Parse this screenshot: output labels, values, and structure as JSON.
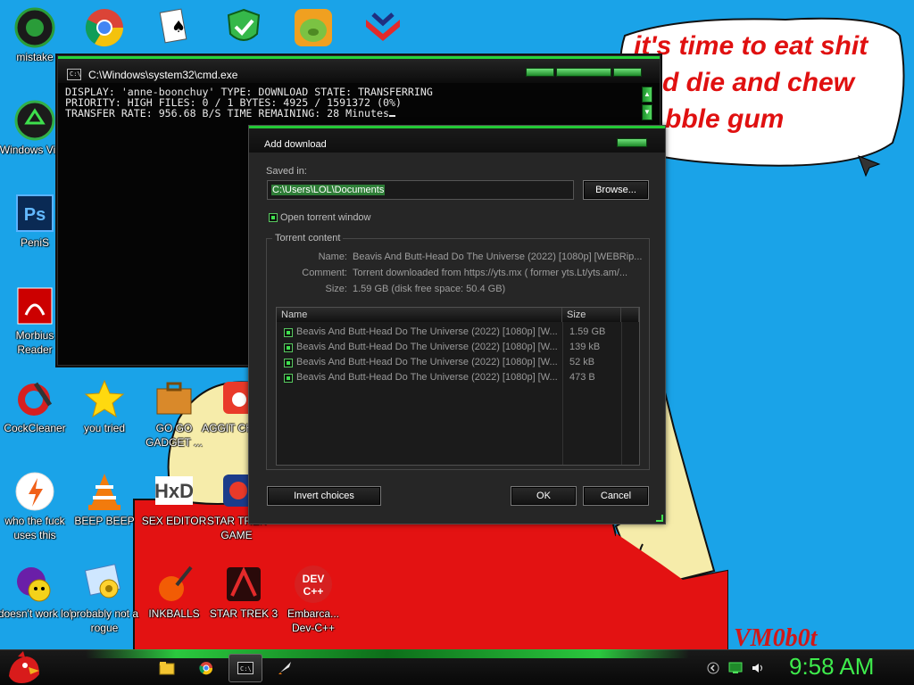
{
  "wallpaper": {
    "bubble_lines": [
      "it's time to eat shit",
      "d die and chew",
      "bble gum"
    ],
    "signature": "VM0b0t"
  },
  "desktop_icons": [
    {
      "label": "mistake",
      "icon": "xbox-app-icon"
    },
    {
      "label": "Windows Vista",
      "icon": "recycle-bin-icon"
    },
    {
      "label": "PeniS",
      "icon": "photoshop-icon"
    },
    {
      "label": "Morbius Reader",
      "icon": "pdf-reader-icon"
    },
    {
      "label": "CockCleaner",
      "icon": "ccleaner-icon"
    },
    {
      "label": "who the fuck uses this",
      "icon": "avast-icon"
    },
    {
      "label": "doesn't work lol",
      "icon": "yahoo-messenger-icon"
    },
    {
      "label": "",
      "icon": "chrome-icon"
    },
    {
      "label": "you tried",
      "icon": "star-icon"
    },
    {
      "label": "BEEP BEEP",
      "icon": "vlc-icon"
    },
    {
      "label": "probably not a rogue",
      "icon": "control-panel-icon"
    },
    {
      "label": "",
      "icon": "solitaire-icon"
    },
    {
      "label": "GO GO GADGET ...",
      "icon": "briefcase-icon"
    },
    {
      "label": "SEX EDITOR",
      "icon": "hxd-icon"
    },
    {
      "label": "INKBALLS",
      "icon": "inkball-icon"
    },
    {
      "label": "",
      "icon": "security-shield-icon"
    },
    {
      "label": "AGGIT CHICK",
      "icon": "angry-birds-icon"
    },
    {
      "label": "STAR TREK GAME",
      "icon": "star-wars-game-icon"
    },
    {
      "label": "STAR TREK 3",
      "icon": "star-wars-3-icon"
    },
    {
      "label": "",
      "icon": "bad-piggies-icon"
    },
    {
      "label": "",
      "icon": "winamp-icon"
    },
    {
      "label": "Embarca... Dev-C++",
      "icon": "dev-cpp-icon"
    }
  ],
  "cmd": {
    "title": "C:\\Windows\\system32\\cmd.exe",
    "app_icon_text": "C:\\",
    "lines": [
      "DISPLAY: 'anne-boonchuy' TYPE: DOWNLOAD STATE: TRANSFERRING",
      "PRIORITY: HIGH FILES: 0 / 1 BYTES: 4925 / 1591372 (0%)",
      "TRANSFER RATE: 956.68 B/S TIME REMAINING: 28 Minutes"
    ],
    "scroll_up": "▲",
    "scroll_down": "▼"
  },
  "dialog": {
    "title": "Add download",
    "saved_in_label": "Saved in:",
    "saved_in_value": "C:\\Users\\LOL\\Documents",
    "browse_label": "Browse...",
    "open_torrent_label": "Open torrent window",
    "open_torrent_checked": true,
    "group_label": "Torrent content",
    "name_key": "Name:",
    "name_value": "Beavis And Butt-Head Do The Universe (2022) [1080p] [WEBRip...",
    "comment_key": "Comment:",
    "comment_value": "Torrent downloaded from https://yts.mx ( former yts.Lt/yts.am/...",
    "size_key": "Size:",
    "size_value": "1.59 GB (disk free space: 50.4 GB)",
    "columns": [
      "Name",
      "Size"
    ],
    "files": [
      {
        "name": "Beavis And Butt-Head Do The Universe (2022) [1080p] [W...",
        "size": "1.59 GB",
        "checked": true
      },
      {
        "name": "Beavis And Butt-Head Do The Universe (2022) [1080p] [W...",
        "size": "139 kB",
        "checked": true
      },
      {
        "name": "Beavis And Butt-Head Do The Universe (2022) [1080p] [W...",
        "size": "52 kB",
        "checked": true
      },
      {
        "name": "Beavis And Butt-Head Do The Universe (2022) [1080p] [W...",
        "size": "473 B",
        "checked": true
      }
    ],
    "invert_label": "Invert choices",
    "ok_label": "OK",
    "cancel_label": "Cancel"
  },
  "taskbar": {
    "clock": "9:58 AM",
    "pinned": [
      "explorer-icon",
      "chrome-icon",
      "cmd-icon",
      "rocket-icon"
    ],
    "active_index": 2,
    "tray": [
      "tray-arrow-icon",
      "network-icon",
      "volume-icon"
    ],
    "accent": "#3eeb4c"
  }
}
